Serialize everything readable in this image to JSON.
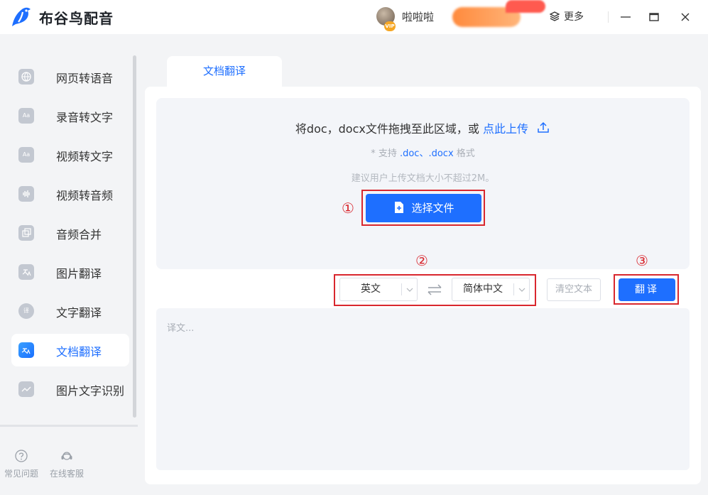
{
  "app": {
    "name": "布谷鸟配音"
  },
  "header": {
    "username": "啦啦啦",
    "vip_badge": "VIP",
    "more_label": "更多"
  },
  "sidebar": {
    "items": [
      {
        "label": "网页转语音",
        "icon": "globe-icon"
      },
      {
        "label": "录音转文字",
        "icon": "text-aa-icon",
        "icon_text": "Aa"
      },
      {
        "label": "视频转文字",
        "icon": "video-text-icon",
        "icon_text": "Aa"
      },
      {
        "label": "视频转音频",
        "icon": "waveform-icon"
      },
      {
        "label": "音频合并",
        "icon": "merge-icon"
      },
      {
        "label": "图片翻译",
        "icon": "image-translate-icon"
      },
      {
        "label": "文字翻译",
        "icon": "text-translate-icon",
        "icon_text": "译"
      },
      {
        "label": "文档翻译",
        "icon": "doc-translate-icon",
        "active": true
      },
      {
        "label": "图片文字识别",
        "icon": "image-ocr-icon"
      }
    ],
    "footer": [
      {
        "label": "常见问题",
        "icon": "question-icon"
      },
      {
        "label": "在线客服",
        "icon": "headset-icon"
      }
    ]
  },
  "main": {
    "tab_label": "文档翻译",
    "drop_text": "将doc，docx文件拖拽至此区域，或",
    "upload_link": "点此上传",
    "support_prefix": "* 支持",
    "support_formats": ".doc、.docx",
    "support_suffix": "格式",
    "hint": "建议用户上传文档大小不超过2M。",
    "choose_file_label": "选择文件",
    "source_lang": "英文",
    "target_lang": "简体中文",
    "clear_label": "清空文本",
    "translate_label": "翻译",
    "result_placeholder": "译文...",
    "annotations": [
      "①",
      "②",
      "③"
    ]
  },
  "colors": {
    "accent": "#1e6fff",
    "annotation_red": "#d9272e"
  }
}
